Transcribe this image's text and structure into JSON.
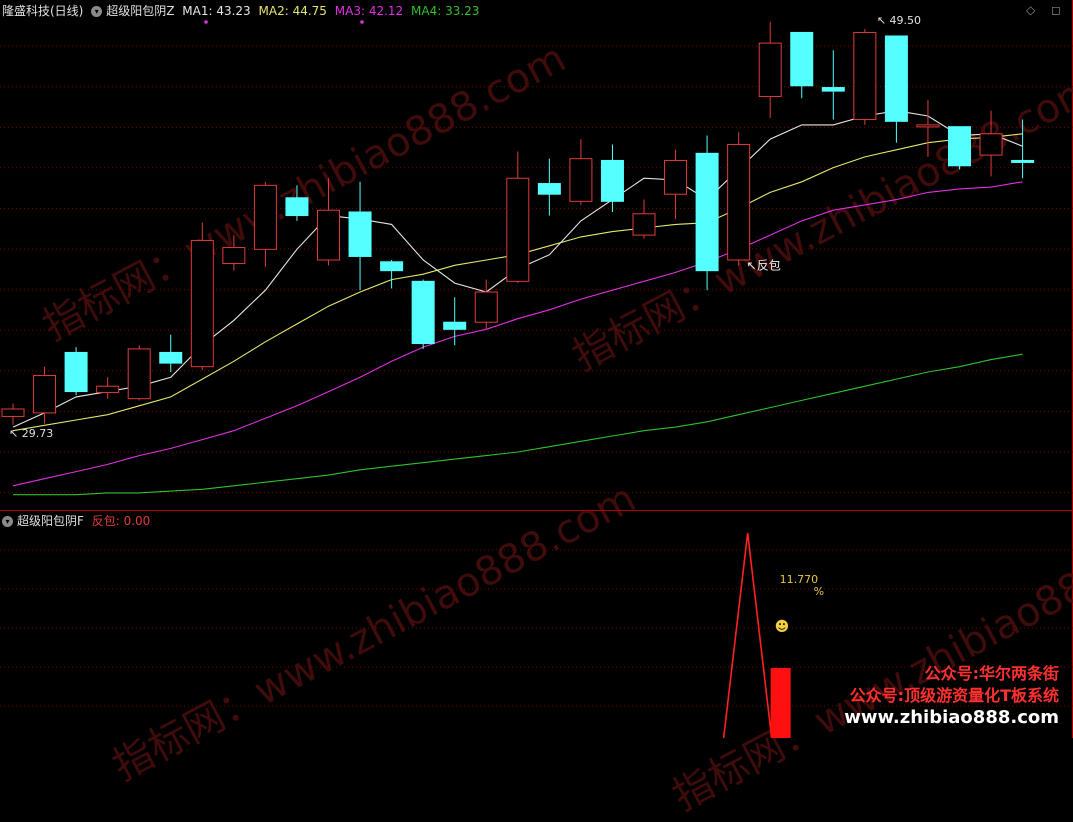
{
  "header": {
    "stock": "隆盛科技(日线)",
    "indicator": "超级阳包阴Z",
    "ma1": "MA1: 43.23",
    "ma2": "MA2: 44.75",
    "ma3": "MA3: 42.12",
    "ma4": "MA4: 33.23",
    "right_icons": "◇ ◻"
  },
  "sub_header": {
    "indicator": "超级阳包阴F",
    "value": "反包: 0.00"
  },
  "annotations": {
    "high": "49.50",
    "low": "29.73",
    "fanbao": "反包",
    "percent_value": "11.770",
    "percent_sign": "%",
    "smiley": "☻"
  },
  "watermarks": [
    "指标网：www.zhibiao888.com",
    "指标网：www.zhibiao888.com",
    "指标网：www.zhibiao888.com",
    "指标网：www.zhibiao888.com"
  ],
  "promo": {
    "line1": "公众号:华尔两条街",
    "line2": "公众号:顶级游资量化T板系统",
    "line3": "www.zhibiao888.com"
  },
  "colors": {
    "up": "#e23a3a",
    "down": "#54ffff",
    "ma1": "#e6e6e6",
    "ma2": "#e6e66e",
    "ma3": "#e030e0",
    "ma4": "#30c030",
    "grid": "#7a0000"
  },
  "chart_data": {
    "type": "candlestick",
    "ylim": [
      25.5,
      52.5
    ],
    "candles": [
      {
        "o": 30.2,
        "c": 30.62,
        "h": 30.93,
        "l": 29.73
      },
      {
        "o": 30.4,
        "c": 32.5,
        "h": 33.0,
        "l": 29.8
      },
      {
        "o": 33.8,
        "c": 31.6,
        "h": 34.1,
        "l": 31.4
      },
      {
        "o": 31.55,
        "c": 31.9,
        "h": 32.4,
        "l": 31.2
      },
      {
        "o": 31.2,
        "c": 34.0,
        "h": 34.2,
        "l": 31.1
      },
      {
        "o": 33.8,
        "c": 33.2,
        "h": 34.8,
        "l": 32.7
      },
      {
        "o": 33.0,
        "c": 40.1,
        "h": 41.1,
        "l": 32.8
      },
      {
        "o": 38.8,
        "c": 39.7,
        "h": 40.4,
        "l": 38.4
      },
      {
        "o": 39.6,
        "c": 43.2,
        "h": 43.4,
        "l": 38.6
      },
      {
        "o": 42.5,
        "c": 41.5,
        "h": 43.2,
        "l": 41.2
      },
      {
        "o": 39.0,
        "c": 41.8,
        "h": 43.6,
        "l": 38.7
      },
      {
        "o": 41.7,
        "c": 39.2,
        "h": 43.4,
        "l": 37.3
      },
      {
        "o": 38.9,
        "c": 38.4,
        "h": 39.0,
        "l": 37.4
      },
      {
        "o": 37.8,
        "c": 34.3,
        "h": 37.9,
        "l": 34.0
      },
      {
        "o": 35.5,
        "c": 35.1,
        "h": 36.9,
        "l": 34.2
      },
      {
        "o": 35.5,
        "c": 37.2,
        "h": 37.9,
        "l": 35.1
      },
      {
        "o": 37.8,
        "c": 43.6,
        "h": 45.1,
        "l": 37.7
      },
      {
        "o": 43.3,
        "c": 42.7,
        "h": 44.7,
        "l": 41.5
      },
      {
        "o": 42.3,
        "c": 44.7,
        "h": 45.8,
        "l": 42.1
      },
      {
        "o": 44.6,
        "c": 42.3,
        "h": 45.5,
        "l": 41.7
      },
      {
        "o": 40.4,
        "c": 41.6,
        "h": 42.4,
        "l": 40.2
      },
      {
        "o": 42.7,
        "c": 44.6,
        "h": 45.2,
        "l": 41.3
      },
      {
        "o": 45.0,
        "c": 38.4,
        "h": 46.0,
        "l": 37.3
      },
      {
        "o": 39.0,
        "c": 45.5,
        "h": 46.2,
        "l": 38.7
      },
      {
        "o": 48.2,
        "c": 51.2,
        "h": 52.4,
        "l": 47.0
      },
      {
        "o": 51.8,
        "c": 48.8,
        "h": 51.8,
        "l": 48.1
      },
      {
        "o": 48.7,
        "c": 48.5,
        "h": 50.8,
        "l": 46.9
      },
      {
        "o": 46.9,
        "c": 51.8,
        "h": 52.0,
        "l": 46.6
      },
      {
        "o": 51.6,
        "c": 46.8,
        "h": 51.6,
        "l": 45.6
      },
      {
        "o": 46.5,
        "c": 46.6,
        "h": 48.0,
        "l": 44.8
      },
      {
        "o": 46.5,
        "c": 44.3,
        "h": 46.5,
        "l": 44.1
      },
      {
        "o": 44.9,
        "c": 46.1,
        "h": 47.4,
        "l": 43.7
      },
      {
        "o": 44.6,
        "c": 44.5,
        "h": 46.9,
        "l": 43.6
      }
    ],
    "ma1": [
      29.6,
      30.4,
      31.3,
      31.6,
      31.9,
      32.4,
      34.2,
      35.6,
      37.3,
      39.6,
      41.5,
      41.3,
      41.0,
      39.0,
      37.7,
      37.2,
      38.5,
      39.3,
      41.2,
      42.4,
      43.6,
      43.5,
      42.4,
      44.1,
      45.8,
      46.6,
      46.6,
      47.1,
      47.4,
      47.1,
      46.0,
      46.1,
      45.4
    ],
    "ma2": [
      29.4,
      29.7,
      30.0,
      30.3,
      30.8,
      31.3,
      32.3,
      33.3,
      34.4,
      35.4,
      36.4,
      37.2,
      37.9,
      38.2,
      38.7,
      39.0,
      39.3,
      39.8,
      40.3,
      40.6,
      40.8,
      41.0,
      41.1,
      41.9,
      42.8,
      43.4,
      44.2,
      44.8,
      45.2,
      45.6,
      45.8,
      45.9,
      46.1
    ],
    "ma3": [
      26.3,
      26.7,
      27.1,
      27.5,
      28.0,
      28.4,
      28.9,
      29.4,
      30.1,
      30.8,
      31.6,
      32.4,
      33.3,
      34.1,
      34.7,
      35.1,
      35.7,
      36.2,
      36.8,
      37.3,
      37.8,
      38.3,
      38.9,
      39.6,
      40.4,
      41.2,
      41.8,
      42.1,
      42.4,
      42.8,
      43.0,
      43.1,
      43.4
    ],
    "ma4": [
      25.8,
      25.8,
      25.8,
      25.9,
      25.9,
      26.0,
      26.1,
      26.3,
      26.5,
      26.7,
      26.9,
      27.2,
      27.4,
      27.6,
      27.8,
      28.0,
      28.2,
      28.5,
      28.8,
      29.1,
      29.4,
      29.6,
      29.9,
      30.3,
      30.7,
      31.1,
      31.5,
      31.9,
      32.3,
      32.7,
      33.0,
      33.4,
      33.7
    ],
    "sub_signal": {
      "index": 23,
      "peak": 11.77,
      "bar": 0.3
    }
  }
}
